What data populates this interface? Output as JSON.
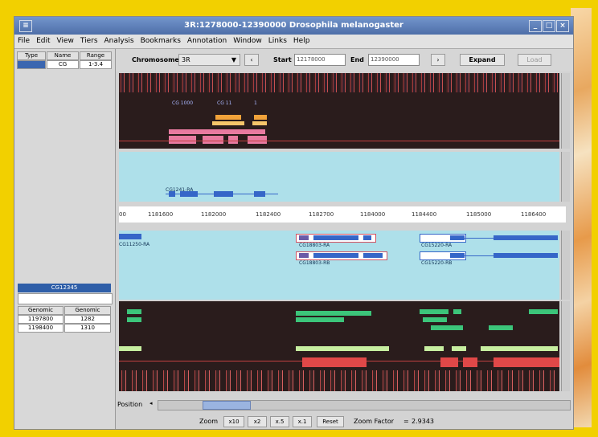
{
  "window": {
    "title": "3R:1278000-12390000 Drosophila melanogaster"
  },
  "menu": [
    "File",
    "Edit",
    "View",
    "Tiers",
    "Analysis",
    "Bookmarks",
    "Annotation",
    "Window",
    "Links",
    "Help"
  ],
  "left_panel": {
    "headers": [
      "Type",
      "Name",
      "Range"
    ],
    "top_row": [
      "",
      "CG",
      "1-3.4"
    ],
    "selected_label": "CG12345",
    "bottom_headers": [
      "Genomic",
      "Genomic"
    ],
    "bottom_rows": [
      [
        "1197800",
        "1282"
      ],
      [
        "1198400",
        "1310"
      ]
    ]
  },
  "toolbar": {
    "chromosome_label": "Chromosome:",
    "chromosome_value": "3R",
    "start_label": "Start",
    "start_value": "12178000",
    "end_label": "End",
    "end_value": "12390000",
    "expand_label": "Expand",
    "load_label": "Load"
  },
  "ruler_ticks": [
    "00",
    "1181600",
    "1182000",
    "1182400",
    "1182700",
    "1184000",
    "1184400",
    "1185000",
    "1186400"
  ],
  "track_labels": {
    "top_row": [
      "CG 1000",
      "CG 11",
      "1"
    ],
    "transcript_1": "CG1241-RA",
    "t3_left": "CG11250-RA",
    "t3_mid1": "CG18803-RA",
    "t3_mid2": "CG18803-RB",
    "t3_right1": "CG15220-RA",
    "t3_right2": "CG15220-RB"
  },
  "position_label": "Position",
  "zoom": {
    "label": "Zoom",
    "buttons": [
      "x10",
      "x2",
      "x.5",
      "x.1",
      "Reset"
    ],
    "factor_label": "Zoom Factor",
    "factor_value": "2.9343"
  },
  "colors": {
    "feature_blue": "#3566c8",
    "orange": "#f1a23a",
    "pink": "#e87aa0",
    "green": "#3cc57a",
    "red": "#e04848",
    "light_green": "#c7eea0"
  }
}
